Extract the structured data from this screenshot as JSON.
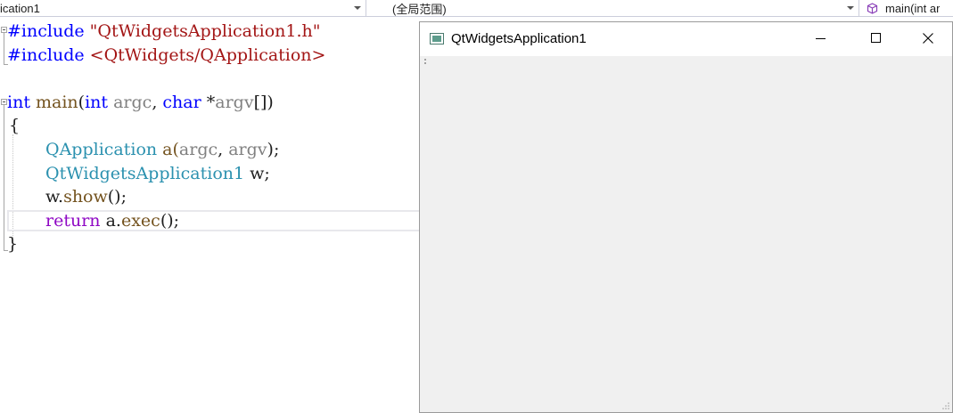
{
  "navbar": {
    "project": "ication1",
    "scope": "(全局范围)",
    "member": "main(int ar"
  },
  "code": {
    "l1": {
      "kw": "#include",
      "str": "\"QtWidgetsApplication1.h\""
    },
    "l2": {
      "kw": "#include",
      "str": "<QtWidgets/QApplication>"
    },
    "l4": {
      "t1": "int",
      "fn": "main",
      "p1": "(",
      "t2": "int",
      "a1": "argc",
      "c1": ", ",
      "t3": "char",
      "ptr": " *",
      "a2": "argv",
      "end": "[])"
    },
    "l5": "{",
    "l6": {
      "type": "QApplication",
      "rest1": " a(",
      "a1": "argc",
      "c": ", ",
      "a2": "argv",
      "end": ");"
    },
    "l7": {
      "type": "QtWidgetsApplication1",
      "rest": " w;"
    },
    "l8": {
      "obj": "w.",
      "fn": "show",
      "end": "();"
    },
    "l9": {
      "kw": "return",
      "obj": " a.",
      "fn": "exec",
      "end": "();"
    },
    "l10": "}"
  },
  "qt_window": {
    "title": "QtWidgetsApplication1"
  },
  "icons": {
    "app": "qt-app-icon",
    "member": "cube-icon",
    "minimize": "minimize-icon",
    "maximize": "maximize-icon",
    "close": "close-icon"
  },
  "colors": {
    "keyword": "#0000ff",
    "control_keyword": "#8f08c4",
    "string": "#a31515",
    "type": "#2b91af",
    "parameter": "#808080",
    "function": "#74531f"
  }
}
